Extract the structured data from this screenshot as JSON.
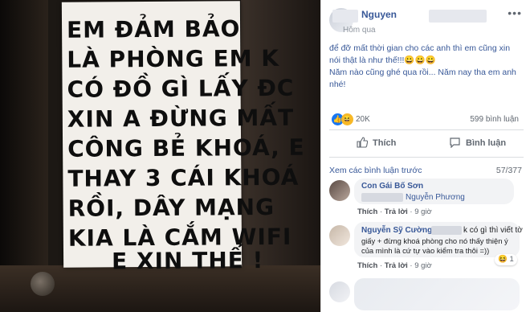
{
  "photo": {
    "handwriting_lines": [
      "EM ĐẢM BẢO",
      "LÀ PHÒNG EM K",
      "CÓ ĐỒ GÌ LẤY ĐC",
      "XIN A ĐỪNG MẤT",
      "CÔNG BẺ KHOÁ, E",
      "THAY 3 CÁI KHOÁ",
      "RỒI, DÂY MẠNG",
      "KIA LÀ CẮM WIFI",
      "E XIN THẾ !"
    ]
  },
  "post": {
    "author": "Nguyen",
    "time": "Hôm qua",
    "menu_icon": "ellipsis-icon",
    "caption_line1": "để đỡ mất thời gian cho các anh thì em cũng xin nói thật là như thế!!!😀😀😀",
    "caption_line2": "Năm nào cũng ghé qua rồi... Năm nay tha em anh nhé!",
    "reactions_count": "20K",
    "comments_count": "599 bình luận",
    "like_label": "Thích",
    "comment_label": "Bình luận"
  },
  "comments_section": {
    "view_previous": "Xem các bình luận trước",
    "pager": "57/377",
    "comments": [
      {
        "name": "Con Gái Bố Sơn",
        "tagged": "Nguyễn Phương",
        "like_label": "Thích",
        "reply_label": "Trả lời",
        "time": "9 giờ"
      },
      {
        "name": "Nguyễn Sỹ Cường",
        "text_line1": "k có gì thì viết tờ",
        "text_line2": "giấy + đừng khoá phòng cho nó thấy thiện ý",
        "text_line3": "của mình là cứ tự vào kiểm tra thôi =))",
        "like_label": "Thích",
        "reply_label": "Trả lời",
        "time": "9 giờ",
        "reaction": "😆",
        "reaction_count": "1"
      }
    ]
  },
  "colors": {
    "link_blue": "#385898",
    "meta_gray": "#606770",
    "bubble_bg": "#f2f3f5"
  }
}
